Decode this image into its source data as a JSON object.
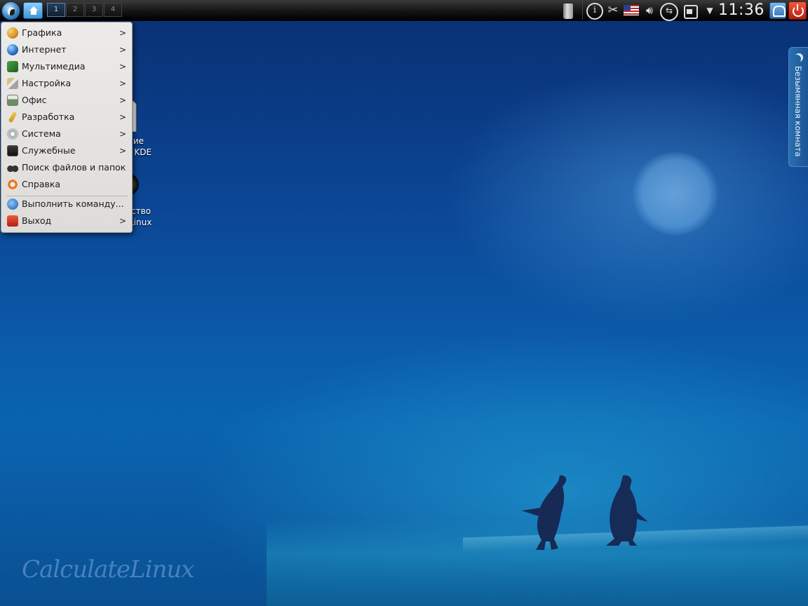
{
  "panel": {
    "pager": [
      "1",
      "2",
      "3",
      "4"
    ],
    "clock": "11:36",
    "icons": [
      "kmenu-icon",
      "home-icon",
      "trash-icon",
      "info-icon",
      "scissors-icon",
      "us-flag-icon",
      "volume-icon",
      "usb-icon",
      "printer-icon",
      "arrow-down-icon",
      "lock-screen-icon",
      "logout-icon"
    ]
  },
  "desktop": {
    "icon1_line1": "ние",
    "icon1_line2": "n KDE",
    "icon2_line1": "ство",
    "icon2_line2": "Linux"
  },
  "menu": {
    "items": [
      {
        "label": "Графика",
        "icon": "graphics-icon"
      },
      {
        "label": "Интернет",
        "icon": "globe-icon"
      },
      {
        "label": "Мультимедиа",
        "icon": "multimedia-icon"
      },
      {
        "label": "Настройка",
        "icon": "settings-icon"
      },
      {
        "label": "Офис",
        "icon": "office-icon"
      },
      {
        "label": "Разработка",
        "icon": "development-icon"
      },
      {
        "label": "Система",
        "icon": "system-icon"
      },
      {
        "label": "Служебные",
        "icon": "utilities-icon"
      },
      {
        "label": "Поиск файлов и папок",
        "icon": "binoculars-icon"
      },
      {
        "label": "Справка",
        "icon": "help-icon"
      },
      {
        "label": "Выполнить команду...",
        "icon": "run-icon"
      },
      {
        "label": "Выход",
        "icon": "exit-icon"
      }
    ],
    "chevron": ">"
  },
  "activity_tab": {
    "label": "Безымянная комната"
  },
  "wallpaper": {
    "brand": "CalculateLinux"
  },
  "colors": {
    "panel": "#141414",
    "menu_bg": "#e6e4e1",
    "wallpaper_top": "#0a2f72",
    "wallpaper_bottom": "#0a4f92",
    "activity_tab": "#1c5595"
  }
}
